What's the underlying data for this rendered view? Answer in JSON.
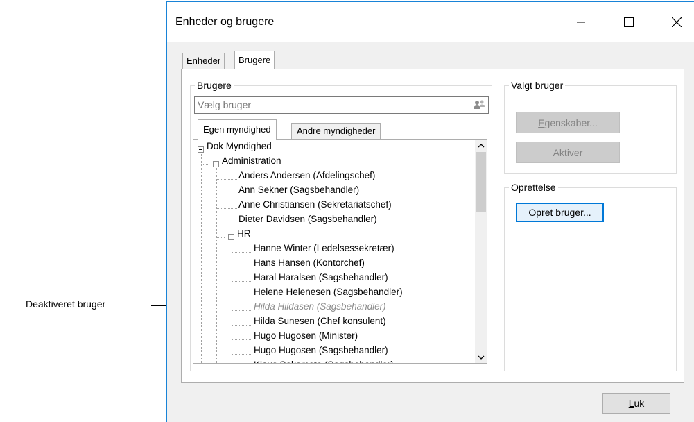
{
  "annotation": {
    "label": "Deaktiveret bruger"
  },
  "window": {
    "title": "Enheder og brugere",
    "minimize": "—",
    "maximize": "☐",
    "close": "✕"
  },
  "tabs": [
    {
      "label": "Enheder"
    },
    {
      "label": "Brugere"
    }
  ],
  "brugere": {
    "legend": "Brugere",
    "search_placeholder": "Vælg bruger",
    "inner_tabs": [
      {
        "label": "Egen myndighed"
      },
      {
        "label": "Andre myndigheder"
      }
    ],
    "tree": [
      {
        "label": "Dok Myndighed",
        "deactivated": false
      },
      {
        "label": "Administration",
        "deactivated": false
      },
      {
        "label": "Anders Andersen (Afdelingschef)",
        "deactivated": false
      },
      {
        "label": "Ann Sekner (Sagsbehandler)",
        "deactivated": false
      },
      {
        "label": "Anne Christiansen (Sekretariatschef)",
        "deactivated": false
      },
      {
        "label": "Dieter Davidsen (Sagsbehandler)",
        "deactivated": false
      },
      {
        "label": "HR",
        "deactivated": false
      },
      {
        "label": "Hanne Winter (Ledelsessekretær)",
        "deactivated": false
      },
      {
        "label": "Hans Hansen (Kontorchef)",
        "deactivated": false
      },
      {
        "label": "Haral Haralsen (Sagsbehandler)",
        "deactivated": false
      },
      {
        "label": "Helene Helenesen (Sagsbehandler)",
        "deactivated": false
      },
      {
        "label": "Hilda Hildasen (Sagsbehandler)",
        "deactivated": true
      },
      {
        "label": "Hilda Sunesen  (Chef konsulent)",
        "deactivated": false
      },
      {
        "label": "Hugo Hugosen (Minister)",
        "deactivated": false
      },
      {
        "label": "Hugo Hugosen (Sagsbehandler)",
        "deactivated": false
      },
      {
        "label": "Klaus Sakamoto (Sagsbehandler)",
        "deactivated": false
      }
    ]
  },
  "valgt_bruger": {
    "legend": "Valgt bruger",
    "egenskaber_mnemonic": "E",
    "egenskaber_rest": "genskaber...",
    "aktiver": "Aktiver"
  },
  "oprettelse": {
    "legend": "Oprettelse",
    "opret_mnemonic": "O",
    "opret_rest": "pret bruger..."
  },
  "footer": {
    "luk_mnemonic": "L",
    "luk_rest": "uk"
  }
}
